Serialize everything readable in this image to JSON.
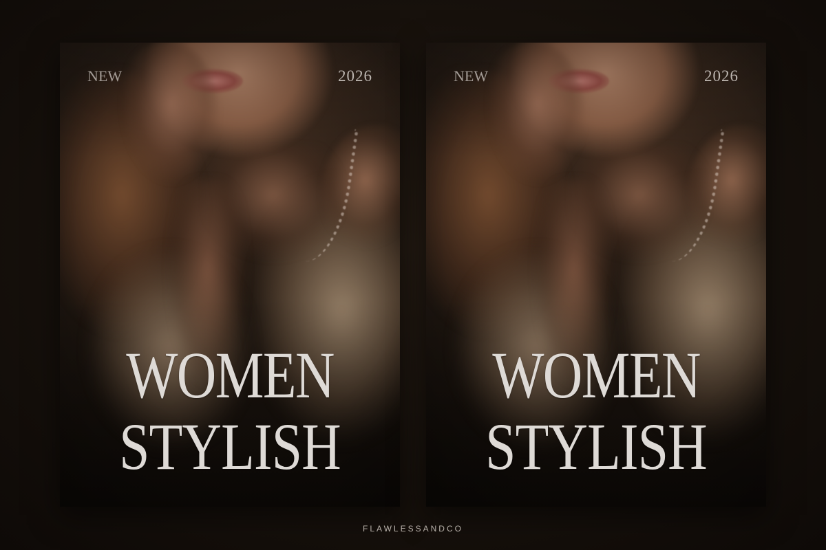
{
  "posters": [
    {
      "tag_left": "NEW",
      "tag_right": "2026",
      "headline_line1": "WOMEN",
      "headline_line2": "STYLISH"
    },
    {
      "tag_left": "NEW",
      "tag_right": "2026",
      "headline_line1": "WOMEN",
      "headline_line2": "STYLISH"
    }
  ],
  "brand": "FLAWLESSANDCO",
  "colors": {
    "background": "#17110c",
    "headline_text": "#dedad6",
    "brand_text": "#b9b2ab"
  }
}
